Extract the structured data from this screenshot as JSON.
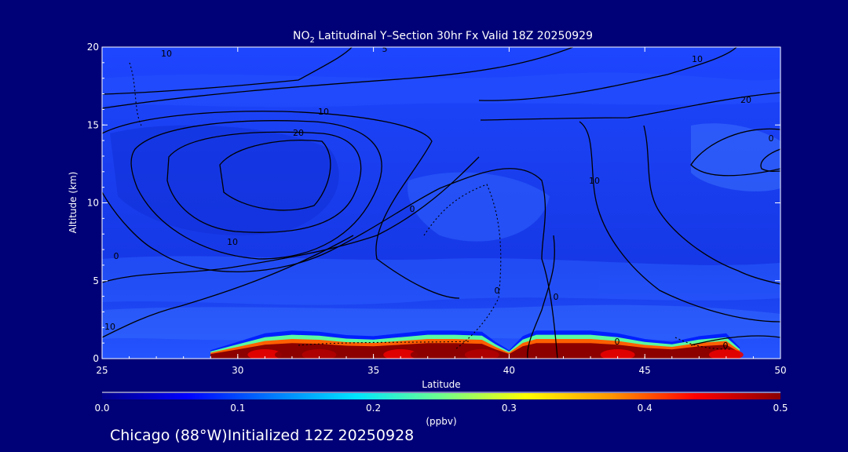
{
  "chart_data": {
    "type": "heatmap",
    "title": {
      "prefix": "NO",
      "sub": "2",
      "suffix": " Latitudinal Y–Section 30hr  Fx Valid 18Z 20250929"
    },
    "xlabel": "Latitude",
    "ylabel": "Altitude (km)",
    "xlim": [
      25,
      50
    ],
    "ylim": [
      0,
      20
    ],
    "x_ticks": [
      "25",
      "30",
      "35",
      "40",
      "45",
      "50"
    ],
    "y_ticks": [
      "0",
      "5",
      "10",
      "15",
      "20"
    ],
    "colorbar": {
      "unit_label": "(ppbv)",
      "range": [
        0.0,
        0.5
      ],
      "ticks": [
        "0.0",
        "0.1",
        "0.2",
        "0.3",
        "0.4",
        "0.5"
      ],
      "colors": [
        "#00008c",
        "#0000ff",
        "#0078ff",
        "#00e6ff",
        "#6eff8c",
        "#ffff00",
        "#ff9600",
        "#ff0000",
        "#8c0000"
      ]
    },
    "contour_labels": [
      "10",
      "5",
      "10",
      "10",
      "20",
      "10",
      "20",
      "0",
      "10",
      "0",
      "10",
      "0",
      "0",
      "0",
      "0",
      "10",
      "0"
    ],
    "surface_profile": {
      "description_free": true,
      "lat": [
        29,
        30,
        31,
        32,
        33,
        34,
        35,
        36,
        37,
        38,
        39,
        39.5,
        40,
        40.5,
        41,
        42,
        43,
        44,
        45,
        46,
        47,
        48,
        48.5
      ],
      "no2_ppbv": [
        0.15,
        0.3,
        0.45,
        0.5,
        0.48,
        0.42,
        0.4,
        0.45,
        0.5,
        0.5,
        0.48,
        0.3,
        0.15,
        0.4,
        0.5,
        0.5,
        0.5,
        0.45,
        0.35,
        0.3,
        0.4,
        0.45,
        0.2
      ]
    }
  },
  "footer": {
    "caption": "Chicago (88°W)Initialized 12Z 20250928"
  }
}
